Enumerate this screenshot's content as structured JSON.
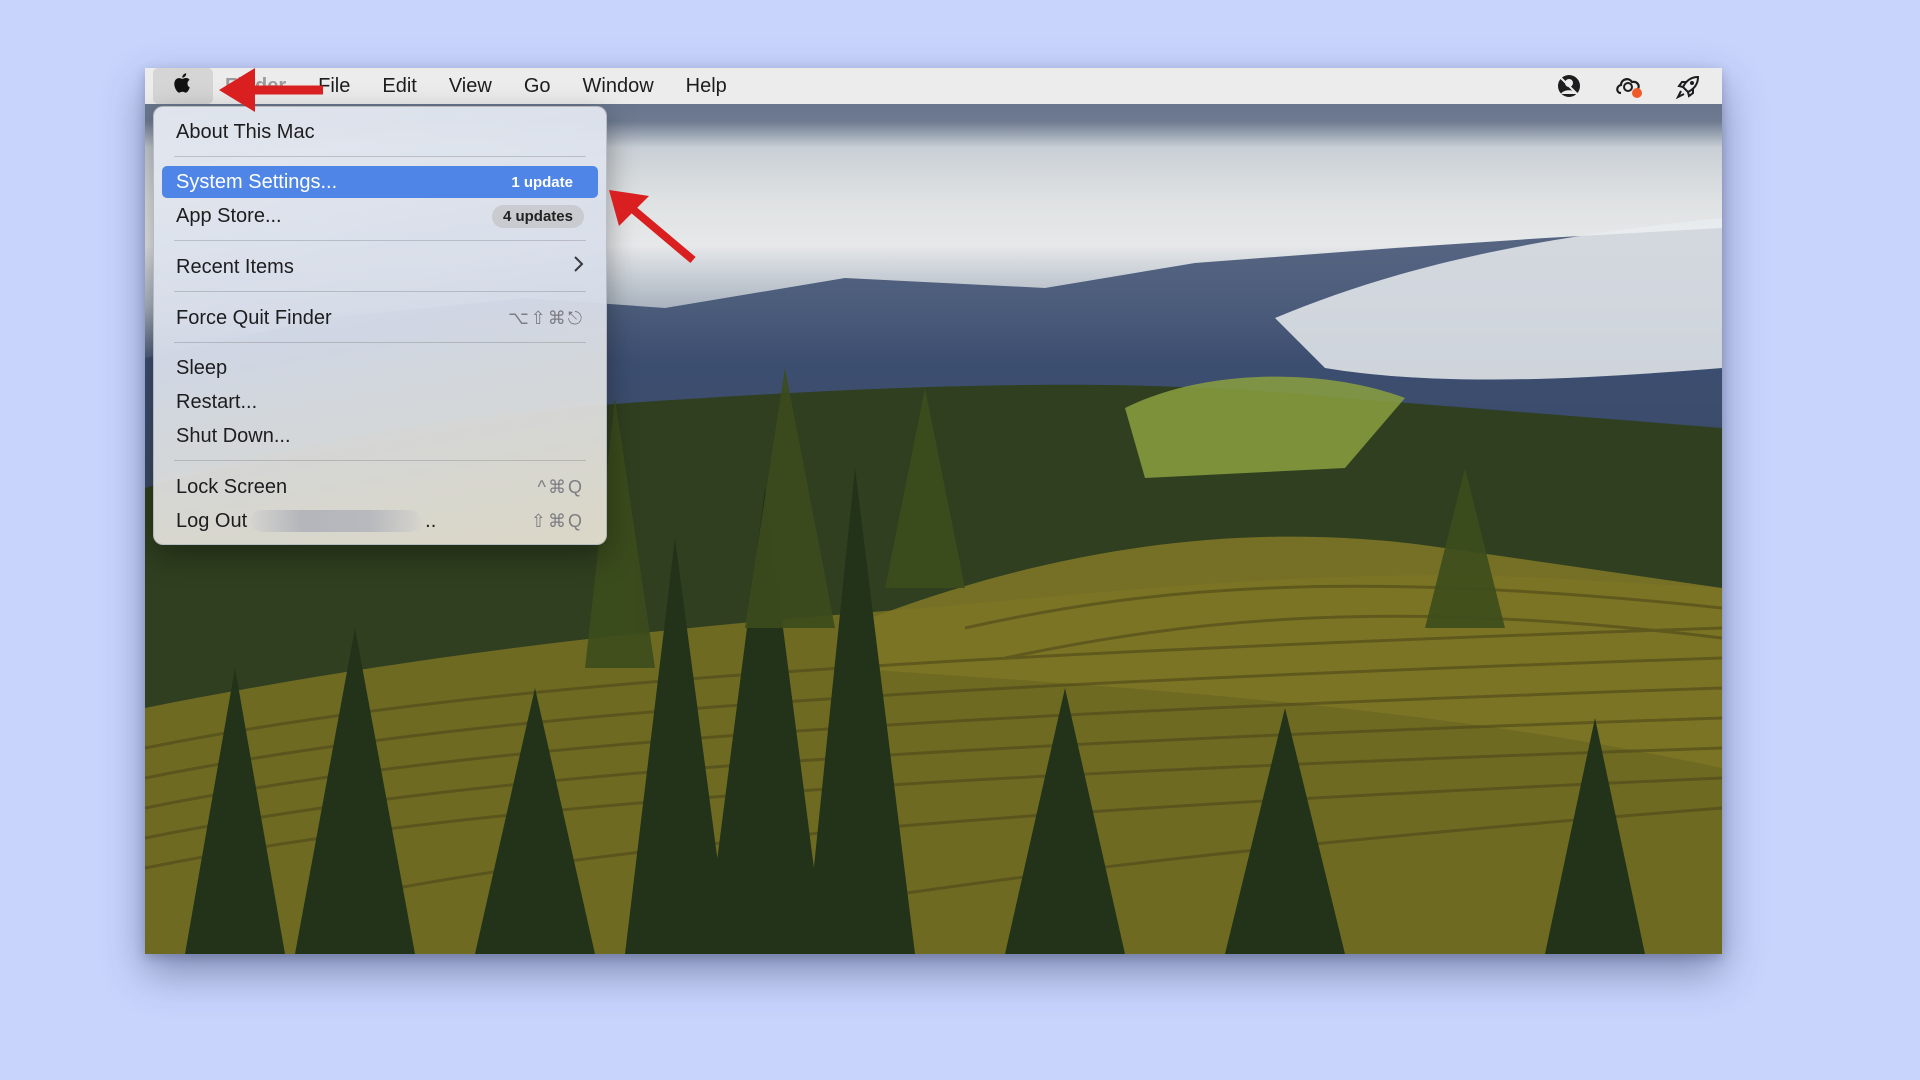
{
  "menubar": {
    "apple_icon": "apple-logo-icon",
    "app_name": "Finder",
    "menus": [
      "File",
      "Edit",
      "View",
      "Go",
      "Window",
      "Help"
    ],
    "status_icons": [
      "person-circle-icon",
      "cloud-sync-icon",
      "rocket-icon"
    ]
  },
  "apple_menu": {
    "about": "About This Mac",
    "system_settings": "System Settings...",
    "system_settings_badge": "1 update",
    "app_store": "App Store...",
    "app_store_badge": "4 updates",
    "recent_items": "Recent Items",
    "force_quit": "Force Quit Finder",
    "force_quit_shortcut": "⌥⇧⌘⎋",
    "sleep": "Sleep",
    "restart": "Restart...",
    "shut_down": "Shut Down...",
    "lock_screen": "Lock Screen",
    "lock_screen_shortcut": "^⌘Q",
    "log_out": "Log Out",
    "log_out_suffix": "..",
    "log_out_shortcut": "⇧⌘Q"
  },
  "annotations": {
    "arrow_color": "#d91f1f",
    "highlight_color": "#4f85e6"
  }
}
